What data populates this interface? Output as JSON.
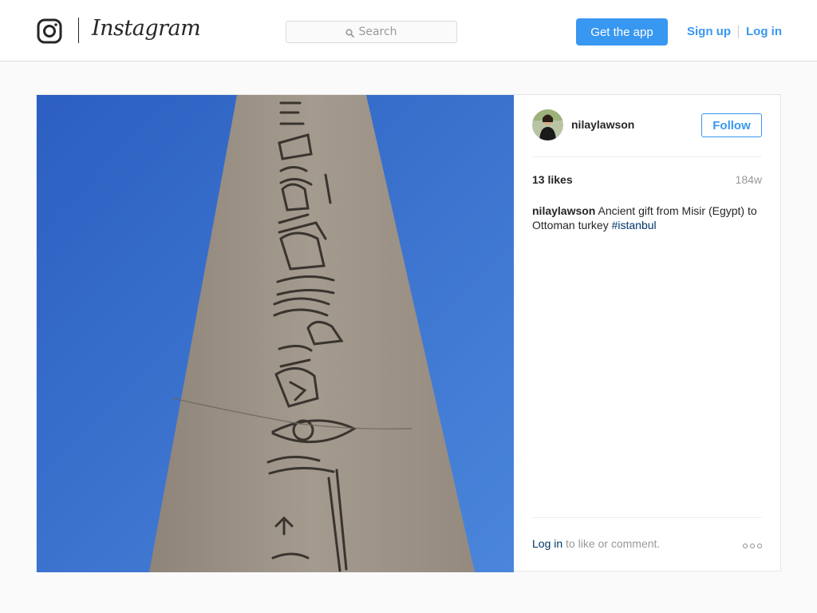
{
  "header": {
    "brand_wordmark": "Instagram",
    "search_placeholder": "Search",
    "get_app_label": "Get the app",
    "sign_up_label": "Sign up",
    "log_in_label": "Log in"
  },
  "post": {
    "image_subject": "Carved stone obelisk with hieroglyphs against blue sky",
    "author": {
      "username": "nilaylawson"
    },
    "follow_label": "Follow",
    "likes_text": "13 likes",
    "timestamp": "184w",
    "caption": {
      "username": "nilaylawson",
      "text": "Ancient gift from Misir (Egypt) to Ottoman turkey",
      "hashtag": "#istanbul"
    },
    "footer": {
      "login_link": "Log in",
      "login_suffix": "to like or comment."
    }
  },
  "colors": {
    "accent": "#3897f0",
    "hashtag": "#003569",
    "muted": "#999999",
    "border": "#dbdbdb",
    "background": "#fafafa"
  },
  "icons": {
    "logo": "instagram-camera-icon",
    "search": "search-icon",
    "more": "more-options-icon"
  }
}
